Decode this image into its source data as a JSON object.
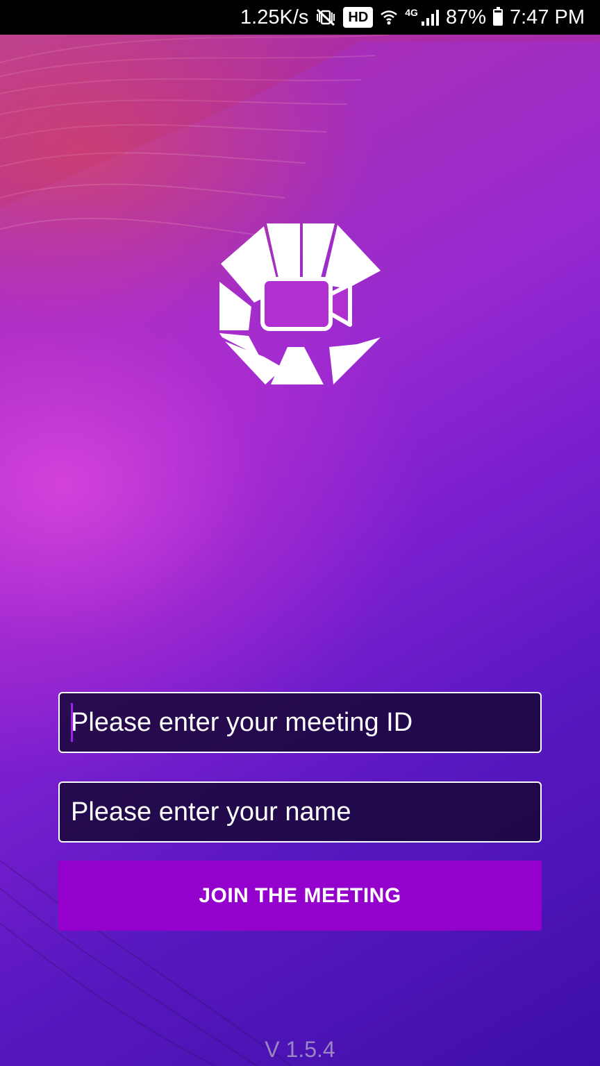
{
  "status_bar": {
    "net_speed": "1.25K/s",
    "hd_badge": "HD",
    "network_type": "4G",
    "battery_percent": "87%",
    "battery_level": 0.87,
    "time": "7:47 PM",
    "icons": [
      "mute-vibrate-icon",
      "wifi-icon",
      "signal-icon",
      "battery-icon"
    ]
  },
  "logo": {
    "icon": "video-camera-icon"
  },
  "form": {
    "meeting_id_placeholder": "Please enter your meeting ID",
    "meeting_id_value": "",
    "name_placeholder": "Please enter your name",
    "name_value": "",
    "join_label": "JOIN THE MEETING"
  },
  "footer": {
    "version": "V 1.5.4"
  },
  "colors": {
    "button": "#9400cc",
    "field_background": "#14063280",
    "field_border": "#ffffff",
    "version_text": "#9a86c4",
    "cursor": "#a020f0"
  }
}
